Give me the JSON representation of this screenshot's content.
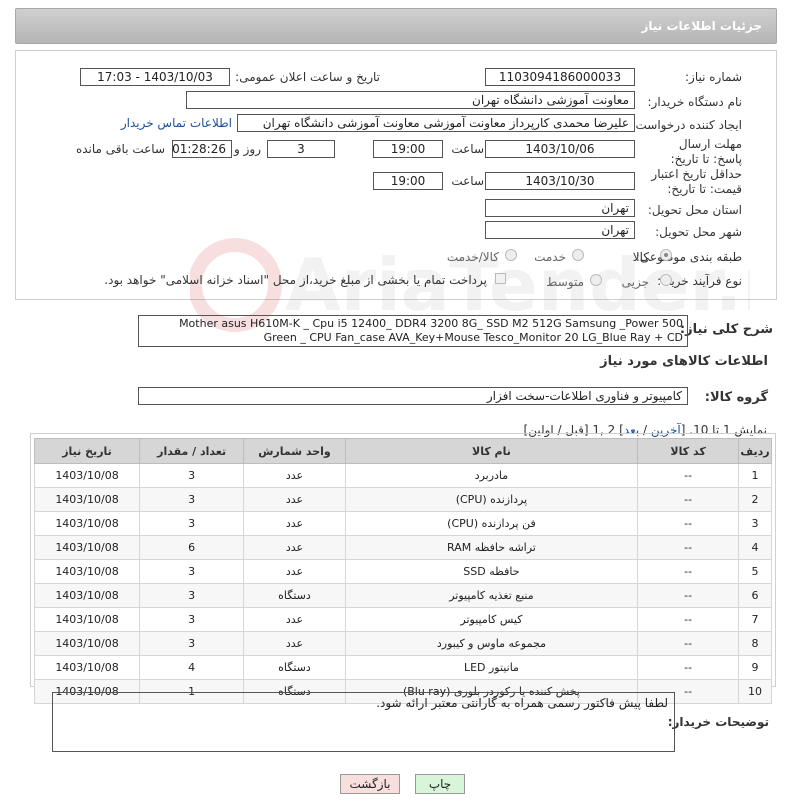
{
  "header": {
    "title": "جزئیات اطلاعات نیاز"
  },
  "fields": {
    "need_number_label": "شماره نیاز:",
    "need_number": "1103094186000033",
    "announce_label": "تاریخ و ساعت اعلان عمومی:",
    "announce_value": "1403/10/03 - 17:03",
    "buyer_org_label": "نام دستگاه خریدار:",
    "buyer_org": "معاونت آموزشی دانشگاه تهران",
    "requester_label": "ایجاد کننده درخواست:",
    "requester": "علیرضا محمدی کارپرداز معاونت آموزشی معاونت آموزشی دانشگاه تهران",
    "contact_link": "اطلاعات تماس خریدار",
    "deadline_label": "مهلت ارسال پاسخ: تا تاریخ:",
    "deadline_date": "1403/10/06",
    "time_label": "ساعت",
    "deadline_time": "19:00",
    "days_value": "3",
    "days_label": "روز و",
    "remaining_time": "01:28:26",
    "remaining_label": "ساعت باقی مانده",
    "validity_label": "حداقل تاریخ اعتبار قیمت: تا تاریخ:",
    "validity_date": "1403/10/30",
    "validity_time": "19:00",
    "province_label": "استان محل تحویل:",
    "province": "تهران",
    "city_label": "شهر محل تحویل:",
    "city": "تهران",
    "category_label": "طبقه بندی موضوعی:",
    "category_options": [
      "کالا",
      "خدمت",
      "کالا/خدمت"
    ],
    "process_label": "نوع فرآیند خرید :",
    "process_options": [
      "جزیی",
      "متوسط"
    ],
    "payment_note": "پرداخت تمام یا بخشی از مبلغ خرید،از محل \"اسناد خزانه اسلامی\" خواهد بود."
  },
  "description": {
    "label": "شرح کلی نیاز:",
    "text": "Mother asus H610M-K _ Cpu i5 12400_ DDR4 3200 8G_ SSD M2 512G Samsung _Power 500 Green _ CPU Fan_case AVA_Key+Mouse Tesco_Monitor 20 LG_Blue Ray + CD"
  },
  "goods_section_title": "اطلاعات کالاهای مورد نیاز",
  "goods_group_label": "گروه کالا:",
  "goods_group": "کامپیوتر و فناوری اطلاعات-سخت افزار",
  "pagination": {
    "prefix": "نمایش 1 تا 10. [",
    "last": "آخرین",
    "sep": " / ",
    "next": "بعد",
    "suffix": "] 2 ,1 [قبل / اولین]"
  },
  "table": {
    "headers": [
      "ردیف",
      "کد کالا",
      "نام کالا",
      "واحد شمارش",
      "تعداد / مقدار",
      "تاریخ نیاز"
    ],
    "rows": [
      [
        "1",
        "--",
        "مادربرد",
        "عدد",
        "3",
        "1403/10/08"
      ],
      [
        "2",
        "--",
        "پردازنده (CPU)",
        "عدد",
        "3",
        "1403/10/08"
      ],
      [
        "3",
        "--",
        "فن پردازنده (CPU)",
        "عدد",
        "3",
        "1403/10/08"
      ],
      [
        "4",
        "--",
        "تراشه حافظه RAM",
        "عدد",
        "6",
        "1403/10/08"
      ],
      [
        "5",
        "--",
        "حافظه SSD",
        "عدد",
        "3",
        "1403/10/08"
      ],
      [
        "6",
        "--",
        "منبع تغذیه کامپیوتر",
        "دستگاه",
        "3",
        "1403/10/08"
      ],
      [
        "7",
        "--",
        "کیس کامپیوتر",
        "عدد",
        "3",
        "1403/10/08"
      ],
      [
        "8",
        "--",
        "مجموعه ماوس و کیبورد",
        "عدد",
        "3",
        "1403/10/08"
      ],
      [
        "9",
        "--",
        "مانیتور LED",
        "دستگاه",
        "4",
        "1403/10/08"
      ],
      [
        "10",
        "--",
        "پخش کننده یا رکوردر بلوری (Blu ray)",
        "دستگاه",
        "1",
        "1403/10/08"
      ]
    ]
  },
  "buyer_notes": {
    "label": "توضیحات خریدار:",
    "text": "لطفا پیش فاکتور رسمی همراه به گارانتی معتبر ارائه شود."
  },
  "buttons": {
    "print": "چاپ",
    "back": "بازگشت"
  }
}
